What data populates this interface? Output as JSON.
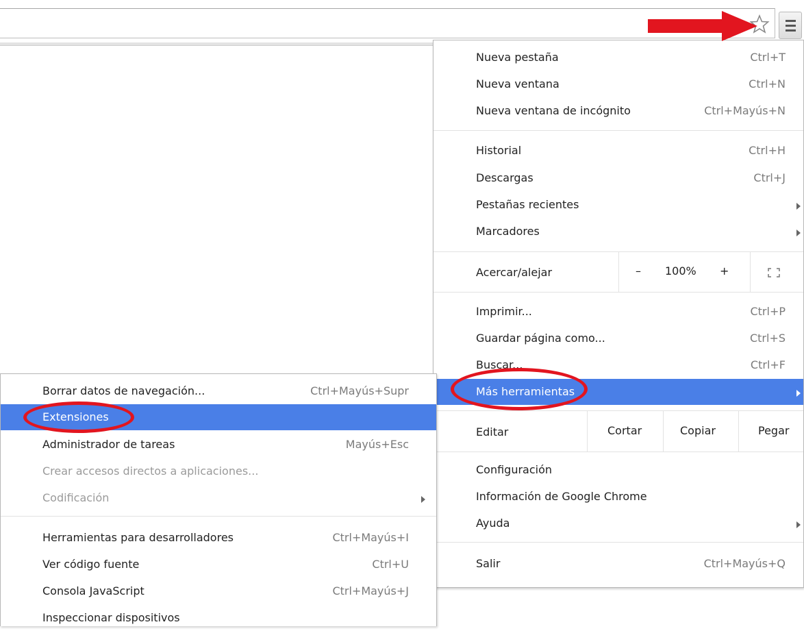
{
  "toolbar": {
    "bookmark_icon": "star-icon",
    "menu_icon": "hamburger-menu-icon"
  },
  "main_menu": {
    "items": [
      {
        "label": "Nueva pestaña",
        "shortcut": "Ctrl+T"
      },
      {
        "label": "Nueva ventana",
        "shortcut": "Ctrl+N"
      },
      {
        "label": "Nueva ventana de incógnito",
        "shortcut": "Ctrl+Mayús+N"
      },
      {
        "label": "Historial",
        "shortcut": "Ctrl+H"
      },
      {
        "label": "Descargas",
        "shortcut": "Ctrl+J"
      },
      {
        "label": "Pestañas recientes",
        "shortcut": ""
      },
      {
        "label": "Marcadores",
        "shortcut": ""
      },
      {
        "label": "Imprimir...",
        "shortcut": "Ctrl+P"
      },
      {
        "label": "Guardar página como...",
        "shortcut": "Ctrl+S"
      },
      {
        "label": "Buscar...",
        "shortcut": "Ctrl+F"
      },
      {
        "label": "Más herramientas",
        "shortcut": ""
      },
      {
        "label": "Configuración",
        "shortcut": ""
      },
      {
        "label": "Información de Google Chrome",
        "shortcut": ""
      },
      {
        "label": "Ayuda",
        "shortcut": ""
      },
      {
        "label": "Salir",
        "shortcut": "Ctrl+Mayús+Q"
      }
    ],
    "zoom": {
      "label": "Acercar/alejar",
      "minus": "–",
      "value": "100%",
      "plus": "+",
      "fullscreen_icon": "fullscreen-icon"
    },
    "edit": {
      "label": "Editar",
      "cut": "Cortar",
      "copy": "Copiar",
      "paste": "Pegar"
    }
  },
  "sub_menu": {
    "items": [
      {
        "label": "Borrar datos de navegación...",
        "shortcut": "Ctrl+Mayús+Supr"
      },
      {
        "label": "Extensiones",
        "shortcut": ""
      },
      {
        "label": "Administrador de tareas",
        "shortcut": "Mayús+Esc"
      },
      {
        "label": "Crear accesos directos a aplicaciones...",
        "shortcut": ""
      },
      {
        "label": "Codificación",
        "shortcut": ""
      },
      {
        "label": "Herramientas para desarrolladores",
        "shortcut": "Ctrl+Mayús+I"
      },
      {
        "label": "Ver código fuente",
        "shortcut": "Ctrl+U"
      },
      {
        "label": "Consola JavaScript",
        "shortcut": "Ctrl+Mayús+J"
      },
      {
        "label": "Inspeccionar dispositivos",
        "shortcut": ""
      }
    ]
  },
  "colors": {
    "highlight": "#4a7fe7",
    "annotation_red": "#e2151f"
  }
}
